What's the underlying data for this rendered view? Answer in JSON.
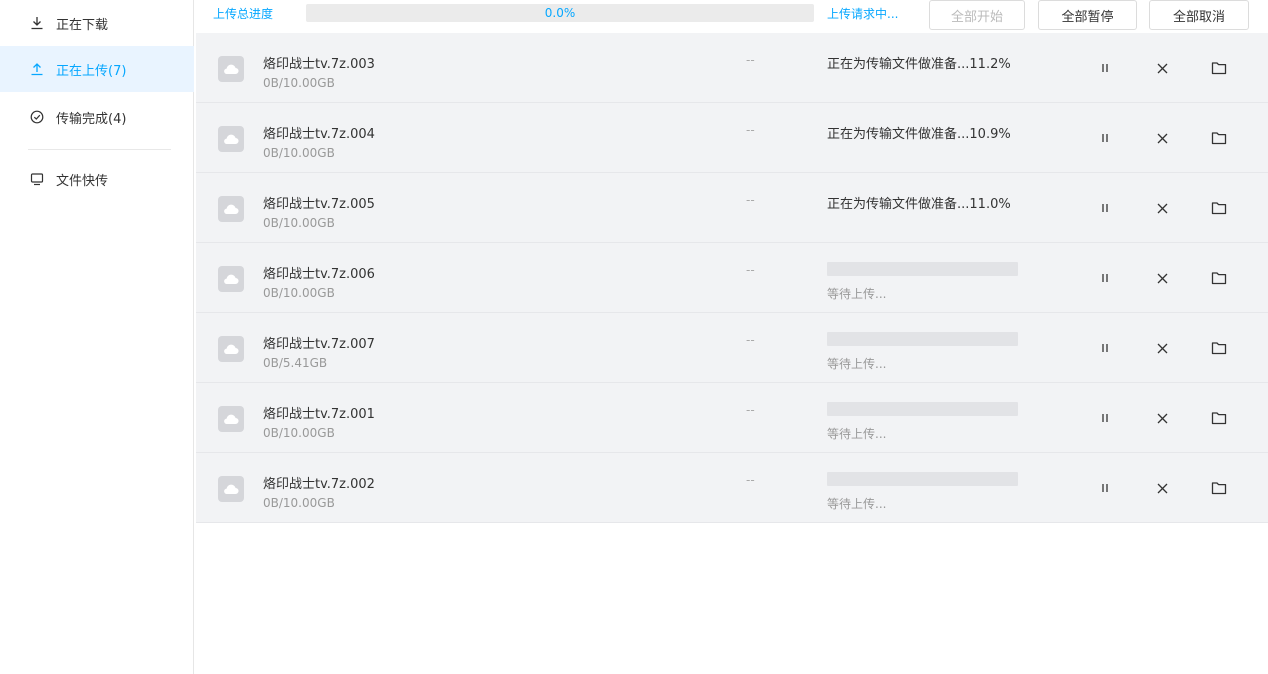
{
  "sidebar": {
    "items": [
      {
        "label": "正在下载",
        "icon": "download-icon"
      },
      {
        "label": "正在上传(7)",
        "icon": "upload-icon"
      },
      {
        "label": "传输完成(4)",
        "icon": "check-circle-icon"
      },
      {
        "label": "文件快传",
        "icon": "monitor-icon"
      }
    ],
    "active_index": 1
  },
  "toolbar": {
    "progress_label": "上传总进度",
    "progress_text": "0.0%",
    "progress_value": 0.0,
    "status_text": "上传请求中...",
    "start_all_label": "全部开始",
    "pause_all_label": "全部暂停",
    "cancel_all_label": "全部取消"
  },
  "colors": {
    "accent": "#06a7ff",
    "row_bg": "#f2f3f5",
    "active_nav_bg": "#e9f4ff"
  },
  "tasks": [
    {
      "name": "烙印战士tv.7z.003",
      "size": "0B/10.00GB",
      "speed": "--",
      "status": "正在为传输文件做准备...11.2%",
      "waiting": false
    },
    {
      "name": "烙印战士tv.7z.004",
      "size": "0B/10.00GB",
      "speed": "--",
      "status": "正在为传输文件做准备...10.9%",
      "waiting": false
    },
    {
      "name": "烙印战士tv.7z.005",
      "size": "0B/10.00GB",
      "speed": "--",
      "status": "正在为传输文件做准备...11.0%",
      "waiting": false
    },
    {
      "name": "烙印战士tv.7z.006",
      "size": "0B/10.00GB",
      "speed": "--",
      "status": "等待上传...",
      "waiting": true
    },
    {
      "name": "烙印战士tv.7z.007",
      "size": "0B/5.41GB",
      "speed": "--",
      "status": "等待上传...",
      "waiting": true
    },
    {
      "name": "烙印战士tv.7z.001",
      "size": "0B/10.00GB",
      "speed": "--",
      "status": "等待上传...",
      "waiting": true
    },
    {
      "name": "烙印战士tv.7z.002",
      "size": "0B/10.00GB",
      "speed": "--",
      "status": "等待上传...",
      "waiting": true
    }
  ],
  "row_actions": {
    "pause_icon": "pause-icon",
    "cancel_icon": "close-icon",
    "folder_icon": "folder-icon"
  }
}
